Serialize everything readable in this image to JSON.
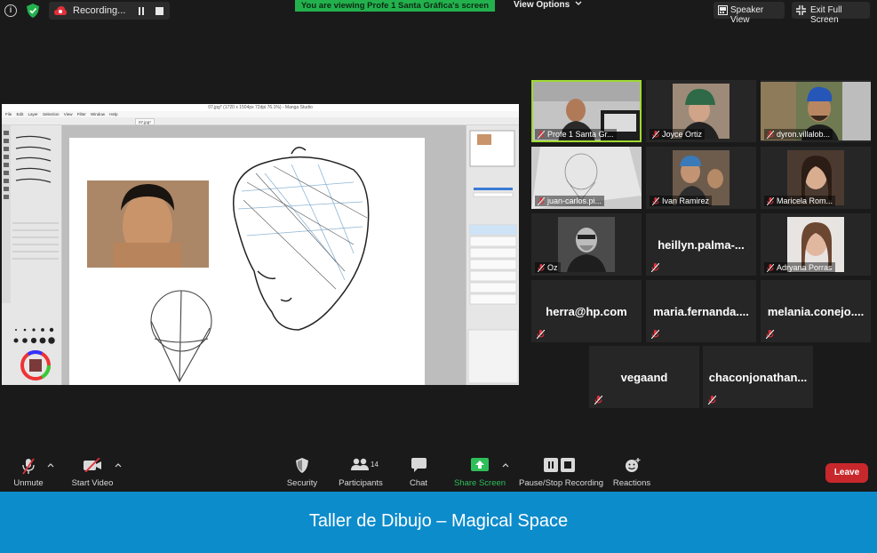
{
  "topbar": {
    "recording_label": "Recording...",
    "viewing_banner": "You are viewing Profe 1 Santa Gráfica's screen",
    "view_options_label": "View Options",
    "speaker_view_label": "Speaker View",
    "exit_full_label": "Exit Full Screen",
    "info_glyph": "i"
  },
  "shared_screen": {
    "app_title": "07.jpg* (1720 x 1504px 72dpi 76.1%) - Manga Studio",
    "menu": "File Edit Layer Selection View Filter Window Help",
    "doc_tab": "07.jpg*"
  },
  "participants": [
    {
      "name": "Profe 1 Santa Gr...",
      "video": true,
      "active": true
    },
    {
      "name": "Joyce Ortiz",
      "video": true
    },
    {
      "name": "dyron.villalob...",
      "video": true
    },
    {
      "name": "juan-carlos.pi...",
      "video": true
    },
    {
      "name": "Ivan Ramirez",
      "video": true
    },
    {
      "name": "Maricela Rom...",
      "video": true
    },
    {
      "name": "Oz",
      "video": true
    },
    {
      "name": "heillyn.palma-...",
      "video": false
    },
    {
      "name": "Adryana Porras",
      "video": true
    },
    {
      "name": "herra@hp.com",
      "video": false
    },
    {
      "name": "maria.fernanda....",
      "video": false
    },
    {
      "name": "melania.conejo....",
      "video": false
    },
    {
      "name": "vegaand",
      "video": false
    },
    {
      "name": "chaconjonathan...",
      "video": false
    }
  ],
  "toolbar": {
    "unmute": "Unmute",
    "start_video": "Start Video",
    "security": "Security",
    "participants": "Participants",
    "participants_count": "14",
    "chat": "Chat",
    "share_screen": "Share Screen",
    "pause_recording": "Pause/Stop Recording",
    "reactions": "Reactions",
    "leave": "Leave"
  },
  "caption": "Taller de Dibujo – Magical Space",
  "colors": {
    "background": "#1a1a1a",
    "banner_green": "#23b14d",
    "share_green": "#2fbf5a",
    "leave_red": "#c8282c",
    "caption_blue": "#0d8ccc",
    "active_border": "#9ed930",
    "muted_red": "#e0303a"
  },
  "icons": [
    "info-icon",
    "shield-icon",
    "cloud-record-icon",
    "pause-icon",
    "stop-icon",
    "chevron-down-icon",
    "speaker-view-icon",
    "exit-fullscreen-icon",
    "mic-muted-icon",
    "video-off-icon",
    "security-shield-icon",
    "participants-icon",
    "chat-icon",
    "share-screen-icon",
    "pause-stop-icon",
    "reactions-icon"
  ]
}
